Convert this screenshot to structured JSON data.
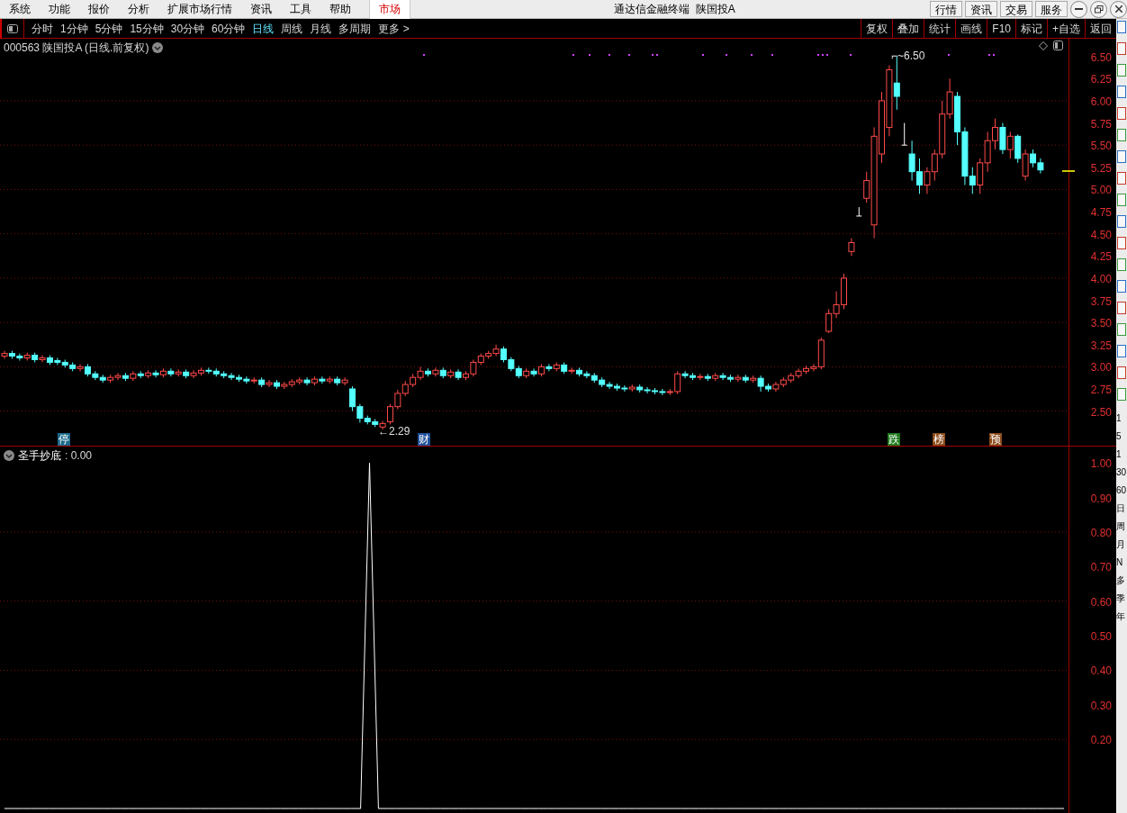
{
  "menu": {
    "items": [
      {
        "label": "系统",
        "selected": false
      },
      {
        "label": "功能",
        "selected": false
      },
      {
        "label": "报价",
        "selected": false
      },
      {
        "label": "分析",
        "selected": false
      },
      {
        "label": "扩展市场行情",
        "selected": false
      },
      {
        "label": "资讯",
        "selected": false
      },
      {
        "label": "工具",
        "selected": false
      },
      {
        "label": "帮助",
        "selected": false
      },
      {
        "label": "市场",
        "selected": true
      }
    ]
  },
  "window": {
    "title": "通达信金融终端  陕国投A"
  },
  "top_buttons": [
    "行情",
    "资讯",
    "交易",
    "服务"
  ],
  "periods": [
    {
      "label": "分时",
      "selected": false
    },
    {
      "label": "1分钟",
      "selected": false
    },
    {
      "label": "5分钟",
      "selected": false
    },
    {
      "label": "15分钟",
      "selected": false
    },
    {
      "label": "30分钟",
      "selected": false
    },
    {
      "label": "60分钟",
      "selected": false
    },
    {
      "label": "日线",
      "selected": true
    },
    {
      "label": "周线",
      "selected": false
    },
    {
      "label": "月线",
      "selected": false
    },
    {
      "label": "多周期",
      "selected": false
    },
    {
      "label": "更多 >",
      "selected": false
    }
  ],
  "tools": [
    "复权",
    "叠加",
    "统计",
    "画线",
    "F10",
    "标记",
    "+自选",
    "返回"
  ],
  "price_chart": {
    "header": "000563 陕国投A (日线.前复权)",
    "high_label": "⌐~6.50",
    "low_label": "←2.29",
    "markers": [
      {
        "label": "停",
        "color": "#1a6a8a"
      },
      {
        "label": "财",
        "color": "#1f4f9a"
      },
      {
        "label": "跌",
        "color": "#1e7a1e"
      },
      {
        "label": "榜",
        "color": "#8a4a1a"
      },
      {
        "label": "预",
        "color": "#8a4a1a"
      }
    ],
    "chart_data": {
      "type": "candlestick",
      "grid": true,
      "ylim": [
        2.1,
        6.7
      ],
      "yticks": [
        {
          "value": 6.5,
          "label": "6.50"
        },
        {
          "value": 6.25,
          "label": "6.25"
        },
        {
          "value": 6,
          "label": "6.00"
        },
        {
          "value": 5.75,
          "label": "5.75"
        },
        {
          "value": 5.5,
          "label": "5.50"
        },
        {
          "value": 5.25,
          "label": "5.25"
        },
        {
          "value": 5,
          "label": "5.00"
        },
        {
          "value": 4.75,
          "label": "4.75"
        },
        {
          "value": 4.5,
          "label": "4.50"
        },
        {
          "value": 4.25,
          "label": "4.25"
        },
        {
          "value": 4,
          "label": "4.00"
        },
        {
          "value": 3.75,
          "label": "3.75"
        },
        {
          "value": 3.5,
          "label": "3.50"
        },
        {
          "value": 3.25,
          "label": "3.25"
        },
        {
          "value": 3,
          "label": "3.00"
        },
        {
          "value": 2.75,
          "label": "2.75"
        },
        {
          "value": 2.5,
          "label": "2.50"
        }
      ],
      "categories": [
        null,
        null,
        null,
        null,
        null,
        null,
        null,
        null,
        null,
        null,
        null,
        null,
        null,
        null,
        null,
        null,
        null,
        null,
        null,
        null,
        null,
        null,
        null,
        null,
        null,
        null,
        null,
        null,
        null,
        null,
        null,
        null,
        null,
        null,
        null,
        null,
        null,
        null,
        null,
        null,
        null,
        null,
        null,
        null,
        null,
        null,
        null,
        null,
        null,
        null,
        null,
        null,
        null,
        null,
        null,
        null,
        null,
        null,
        null,
        null,
        null,
        null,
        null,
        null,
        null,
        null,
        null,
        null,
        null,
        null,
        null,
        null,
        null,
        null,
        null,
        null,
        null,
        null,
        null,
        null,
        null,
        null,
        null,
        null,
        null,
        null,
        null,
        null,
        null,
        null,
        null,
        null,
        null,
        null,
        null,
        null,
        null,
        null,
        null,
        null,
        null,
        null,
        null,
        null,
        null,
        null,
        null,
        null,
        null,
        null,
        null,
        null,
        null,
        null,
        null,
        null,
        null,
        null,
        null,
        null,
        null,
        null,
        null,
        null,
        null,
        null,
        null,
        null,
        null,
        null,
        null,
        null,
        null,
        null,
        null,
        null,
        null,
        null
      ],
      "ohlc": [
        [
          3.12,
          3.18,
          3.09,
          3.15
        ],
        [
          3.15,
          3.18,
          3.09,
          3.12
        ],
        [
          3.12,
          3.15,
          3.07,
          3.1
        ],
        [
          3.1,
          3.16,
          3.07,
          3.13
        ],
        [
          3.13,
          3.16,
          3.05,
          3.08
        ],
        [
          3.08,
          3.13,
          3.05,
          3.1
        ],
        [
          3.1,
          3.13,
          3.02,
          3.05
        ],
        [
          3.07,
          3.1,
          3.02,
          3.05
        ],
        [
          3.05,
          3.08,
          2.99,
          3.02
        ],
        [
          3.02,
          3.05,
          2.95,
          2.98
        ],
        [
          2.98,
          3.03,
          2.95,
          3.0
        ],
        [
          3.0,
          3.03,
          2.89,
          2.92
        ],
        [
          2.92,
          2.95,
          2.85,
          2.88
        ],
        [
          2.88,
          2.91,
          2.82,
          2.85
        ],
        [
          2.85,
          2.91,
          2.82,
          2.88
        ],
        [
          2.88,
          2.93,
          2.85,
          2.9
        ],
        [
          2.9,
          2.93,
          2.84,
          2.87
        ],
        [
          2.87,
          2.95,
          2.84,
          2.92
        ],
        [
          2.92,
          2.95,
          2.87,
          2.9
        ],
        [
          2.9,
          2.96,
          2.87,
          2.93
        ],
        [
          2.93,
          2.96,
          2.88,
          2.91
        ],
        [
          2.91,
          2.98,
          2.88,
          2.95
        ],
        [
          2.95,
          2.98,
          2.89,
          2.92
        ],
        [
          2.92,
          2.97,
          2.89,
          2.94
        ],
        [
          2.94,
          2.97,
          2.87,
          2.9
        ],
        [
          2.9,
          2.96,
          2.87,
          2.93
        ],
        [
          2.93,
          2.99,
          2.9,
          2.96
        ],
        [
          2.96,
          2.99,
          2.92,
          2.95
        ],
        [
          2.95,
          2.98,
          2.89,
          2.92
        ],
        [
          2.92,
          2.95,
          2.87,
          2.9
        ],
        [
          2.9,
          2.93,
          2.85,
          2.88
        ],
        [
          2.88,
          2.91,
          2.83,
          2.86
        ],
        [
          2.86,
          2.89,
          2.81,
          2.84
        ],
        [
          2.84,
          2.88,
          2.81,
          2.85
        ],
        [
          2.85,
          2.88,
          2.77,
          2.8
        ],
        [
          2.8,
          2.85,
          2.77,
          2.82
        ],
        [
          2.82,
          2.85,
          2.75,
          2.78
        ],
        [
          2.78,
          2.83,
          2.75,
          2.8
        ],
        [
          2.8,
          2.86,
          2.77,
          2.83
        ],
        [
          2.83,
          2.88,
          2.8,
          2.85
        ],
        [
          2.85,
          2.88,
          2.79,
          2.82
        ],
        [
          2.82,
          2.89,
          2.79,
          2.86
        ],
        [
          2.86,
          2.89,
          2.81,
          2.84
        ],
        [
          2.84,
          2.89,
          2.81,
          2.86
        ],
        [
          2.86,
          2.89,
          2.79,
          2.82
        ],
        [
          2.82,
          2.88,
          2.79,
          2.85
        ],
        [
          2.75,
          2.78,
          2.5,
          2.55
        ],
        [
          2.55,
          2.58,
          2.37,
          2.42
        ],
        [
          2.42,
          2.45,
          2.35,
          2.38
        ],
        [
          2.38,
          2.41,
          2.32,
          2.35
        ],
        [
          2.32,
          2.39,
          2.29,
          2.36
        ],
        [
          2.38,
          2.58,
          2.35,
          2.55
        ],
        [
          2.55,
          2.74,
          2.52,
          2.7
        ],
        [
          2.7,
          2.84,
          2.67,
          2.8
        ],
        [
          2.8,
          2.92,
          2.77,
          2.88
        ],
        [
          2.88,
          3.0,
          2.85,
          2.95
        ],
        [
          2.95,
          2.98,
          2.89,
          2.92
        ],
        [
          2.92,
          2.99,
          2.89,
          2.96
        ],
        [
          2.96,
          2.99,
          2.87,
          2.9
        ],
        [
          2.9,
          2.97,
          2.87,
          2.94
        ],
        [
          2.94,
          2.97,
          2.85,
          2.88
        ],
        [
          2.88,
          2.95,
          2.85,
          2.92
        ],
        [
          2.92,
          3.08,
          2.89,
          3.05
        ],
        [
          3.05,
          3.15,
          3.02,
          3.12
        ],
        [
          3.12,
          3.18,
          3.09,
          3.15
        ],
        [
          3.15,
          3.25,
          3.12,
          3.2
        ],
        [
          3.2,
          3.23,
          3.05,
          3.08
        ],
        [
          3.08,
          3.11,
          2.95,
          2.98
        ],
        [
          2.98,
          3.01,
          2.87,
          2.9
        ],
        [
          2.9,
          2.98,
          2.87,
          2.95
        ],
        [
          2.95,
          2.98,
          2.89,
          2.92
        ],
        [
          2.92,
          3.03,
          2.89,
          3.0
        ],
        [
          3.0,
          3.03,
          2.95,
          2.98
        ],
        [
          2.98,
          3.05,
          2.95,
          3.02
        ],
        [
          3.02,
          3.05,
          2.92,
          2.95
        ],
        [
          2.95,
          2.99,
          2.92,
          2.96
        ],
        [
          2.96,
          2.99,
          2.89,
          2.92
        ],
        [
          2.92,
          2.95,
          2.87,
          2.9
        ],
        [
          2.9,
          2.93,
          2.82,
          2.85
        ],
        [
          2.85,
          2.88,
          2.77,
          2.8
        ],
        [
          2.8,
          2.83,
          2.75,
          2.78
        ],
        [
          2.78,
          2.81,
          2.73,
          2.76
        ],
        [
          2.76,
          2.79,
          2.72,
          2.75
        ],
        [
          2.75,
          2.8,
          2.72,
          2.77
        ],
        [
          2.77,
          2.8,
          2.71,
          2.74
        ],
        [
          2.74,
          2.77,
          2.7,
          2.73
        ],
        [
          2.73,
          2.76,
          2.69,
          2.72
        ],
        [
          2.72,
          2.75,
          2.68,
          2.71
        ],
        [
          2.71,
          2.75,
          2.68,
          2.72
        ],
        [
          2.72,
          2.95,
          2.69,
          2.92
        ],
        [
          2.92,
          2.95,
          2.87,
          2.9
        ],
        [
          2.9,
          2.93,
          2.85,
          2.88
        ],
        [
          2.88,
          2.92,
          2.85,
          2.89
        ],
        [
          2.89,
          2.92,
          2.84,
          2.87
        ],
        [
          2.87,
          2.93,
          2.84,
          2.9
        ],
        [
          2.9,
          2.93,
          2.85,
          2.88
        ],
        [
          2.88,
          2.91,
          2.83,
          2.86
        ],
        [
          2.86,
          2.91,
          2.83,
          2.88
        ],
        [
          2.88,
          2.91,
          2.82,
          2.85
        ],
        [
          2.85,
          2.9,
          2.82,
          2.87
        ],
        [
          2.87,
          2.9,
          2.72,
          2.78
        ],
        [
          2.78,
          2.81,
          2.72,
          2.75
        ],
        [
          2.75,
          2.83,
          2.72,
          2.8
        ],
        [
          2.8,
          2.88,
          2.77,
          2.85
        ],
        [
          2.85,
          2.93,
          2.82,
          2.9
        ],
        [
          2.9,
          2.98,
          2.87,
          2.95
        ],
        [
          2.95,
          3.01,
          2.92,
          2.98
        ],
        [
          2.98,
          3.03,
          2.95,
          3.0
        ],
        [
          3.0,
          3.33,
          2.97,
          3.3
        ],
        [
          3.4,
          3.65,
          3.38,
          3.6
        ],
        [
          3.6,
          3.85,
          3.55,
          3.7
        ],
        [
          3.7,
          4.05,
          3.65,
          4.0
        ],
        [
          4.3,
          4.45,
          4.25,
          4.4
        ],
        [
          4.7,
          4.8,
          4.7,
          4.7
        ],
        [
          4.9,
          5.2,
          4.85,
          5.1
        ],
        [
          4.6,
          5.7,
          4.45,
          5.6
        ],
        [
          5.4,
          6.1,
          5.3,
          6.0
        ],
        [
          5.7,
          6.4,
          5.6,
          6.35
        ],
        [
          6.2,
          6.5,
          5.9,
          6.05
        ],
        [
          5.5,
          5.75,
          5.5,
          5.5
        ],
        [
          5.4,
          5.55,
          5.1,
          5.2
        ],
        [
          5.2,
          5.35,
          4.95,
          5.05
        ],
        [
          5.05,
          5.25,
          4.95,
          5.2
        ],
        [
          5.2,
          5.45,
          5.1,
          5.4
        ],
        [
          5.4,
          6.0,
          5.35,
          5.85
        ],
        [
          5.85,
          6.25,
          5.8,
          6.1
        ],
        [
          6.05,
          6.1,
          5.5,
          5.65
        ],
        [
          5.65,
          5.7,
          5.05,
          5.15
        ],
        [
          5.15,
          5.25,
          4.95,
          5.05
        ],
        [
          5.05,
          5.35,
          4.95,
          5.3
        ],
        [
          5.3,
          5.65,
          5.2,
          5.55
        ],
        [
          5.55,
          5.8,
          5.45,
          5.7
        ],
        [
          5.7,
          5.75,
          5.4,
          5.45
        ],
        [
          5.45,
          5.65,
          5.35,
          5.6
        ],
        [
          5.6,
          5.62,
          5.3,
          5.35
        ],
        [
          5.15,
          5.45,
          5.1,
          5.4
        ],
        [
          5.4,
          5.45,
          5.25,
          5.3
        ],
        [
          5.3,
          5.35,
          5.18,
          5.22
        ]
      ]
    }
  },
  "indicator": {
    "value": ": 0.00",
    "chart_data": {
      "type": "line",
      "grid": true,
      "ylim": [
        0,
        1.05
      ],
      "categories": [
        null,
        null,
        null,
        null,
        null,
        null,
        null,
        null,
        null,
        null,
        null,
        null,
        null,
        null,
        null,
        null,
        null,
        null,
        null,
        null,
        null,
        null,
        null,
        null,
        null,
        null,
        null,
        null,
        null,
        null,
        null,
        null,
        null,
        null,
        null,
        null,
        null,
        null,
        null,
        null,
        null,
        null,
        null,
        null,
        null,
        null,
        null,
        null,
        null,
        null,
        null,
        null,
        null,
        null,
        null,
        null,
        null,
        null,
        null,
        null,
        null,
        null,
        null,
        null,
        null,
        null,
        null,
        null,
        null,
        null,
        null,
        null,
        null,
        null,
        null,
        null,
        null,
        null,
        null,
        null,
        null,
        null,
        null,
        null,
        null,
        null,
        null,
        null,
        null,
        null,
        null,
        null,
        null,
        null,
        null,
        null,
        null,
        null,
        null,
        null,
        null,
        null,
        null,
        null,
        null,
        null,
        null,
        null,
        null,
        null,
        null,
        null,
        null,
        null,
        null,
        null,
        null,
        null,
        null,
        null
      ],
      "series": [
        {
          "name": "圣手抄底",
          "color": "#ffffff",
          "values": [
            0,
            0,
            0,
            0,
            0,
            0,
            0,
            0,
            0,
            0,
            0,
            0,
            0,
            0,
            0,
            0,
            0,
            0,
            0,
            0,
            0,
            0,
            0,
            0,
            0,
            0,
            0,
            0,
            0,
            0,
            0,
            0,
            0,
            0,
            0,
            0,
            0,
            0,
            0,
            0,
            0,
            1,
            0,
            0,
            0,
            0,
            0,
            0,
            0,
            0,
            0,
            0,
            0,
            0,
            0,
            0,
            0,
            0,
            0,
            0,
            0,
            0,
            0,
            0,
            0,
            0,
            0,
            0,
            0,
            0,
            0,
            0,
            0,
            0,
            0,
            0,
            0,
            0,
            0,
            0,
            0,
            0,
            0,
            0,
            0,
            0,
            0,
            0,
            0,
            0,
            0,
            0,
            0,
            0,
            0,
            0,
            0,
            0,
            0,
            0,
            0,
            0,
            0,
            0,
            0,
            0,
            0,
            0,
            0,
            0,
            0,
            0,
            0,
            0,
            0,
            0,
            0,
            0,
            0,
            0
          ]
        }
      ],
      "yticks": [
        {
          "value": 1,
          "label": "1.00"
        },
        {
          "value": 0.9,
          "label": "0.90"
        },
        {
          "value": 0.8,
          "label": "0.80"
        },
        {
          "value": 0.7,
          "label": "0.70"
        },
        {
          "value": 0.6,
          "label": "0.60"
        },
        {
          "value": 0.5,
          "label": "0.50"
        },
        {
          "value": 0.4,
          "label": "0.40"
        },
        {
          "value": 0.3,
          "label": "0.30"
        },
        {
          "value": 0.2,
          "label": "0.20"
        }
      ]
    }
  },
  "side_labels": [
    "1",
    "5",
    "1",
    "30",
    "60",
    "日",
    "周",
    "月",
    "N",
    "多",
    "季",
    "年"
  ]
}
